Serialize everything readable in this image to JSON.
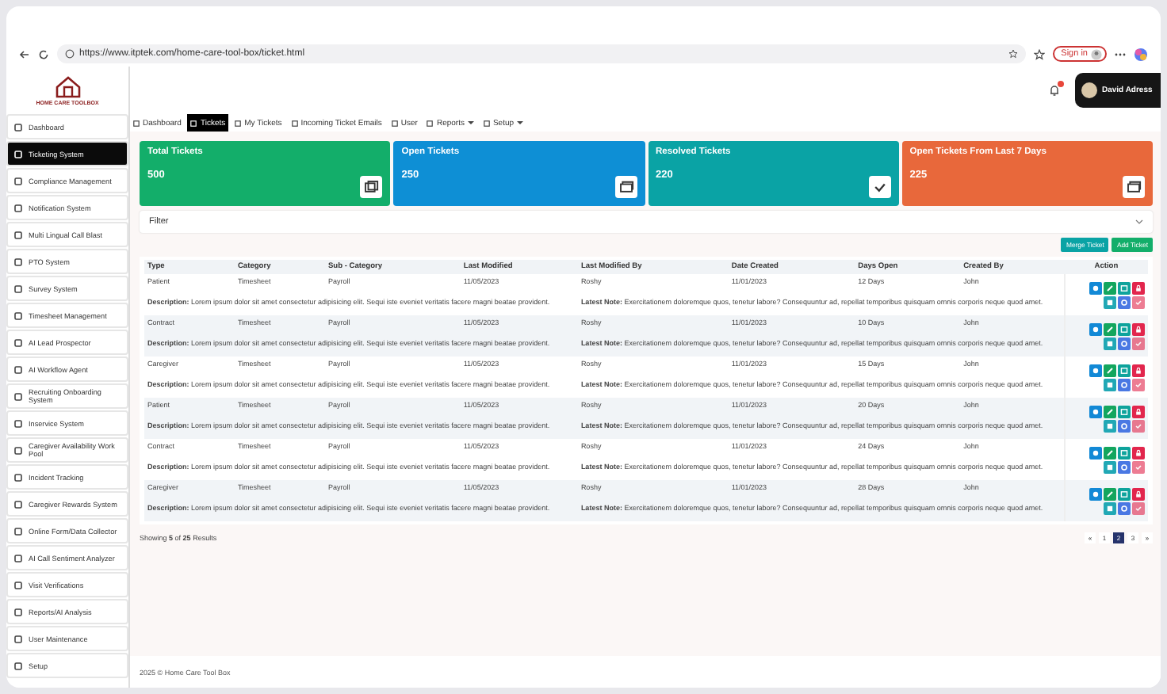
{
  "browser": {
    "url": "https://www.itptek.com/home-care-tool-box/ticket.html",
    "sign_in": "Sign in"
  },
  "logo": {
    "name": "HOME CARE TOOLBOX"
  },
  "sidebar": {
    "items": [
      {
        "label": "Dashboard",
        "selected": false
      },
      {
        "label": "Ticketing System",
        "selected": true
      },
      {
        "label": "Compliance Management",
        "selected": false
      },
      {
        "label": "Notification System",
        "selected": false
      },
      {
        "label": "Multi Lingual Call Blast",
        "selected": false
      },
      {
        "label": "PTO System",
        "selected": false
      },
      {
        "label": "Survey System",
        "selected": false
      },
      {
        "label": "Timesheet Management",
        "selected": false
      },
      {
        "label": "AI Lead Prospector",
        "selected": false
      },
      {
        "label": "AI Workflow Agent",
        "selected": false
      },
      {
        "label": "Recruiting Onboarding System",
        "selected": false
      },
      {
        "label": "Inservice System",
        "selected": false
      },
      {
        "label": "Caregiver Availability Work Pool",
        "selected": false
      },
      {
        "label": "Incident Tracking",
        "selected": false
      },
      {
        "label": "Caregiver Rewards System",
        "selected": false
      },
      {
        "label": "Online Form/Data Collector",
        "selected": false
      },
      {
        "label": "AI Call Sentiment Analyzer",
        "selected": false
      },
      {
        "label": "Visit Verifications",
        "selected": false
      },
      {
        "label": "Reports/AI Analysis",
        "selected": false
      },
      {
        "label": "User Maintenance",
        "selected": false
      },
      {
        "label": "Setup",
        "selected": false
      }
    ]
  },
  "header": {
    "user": "David Adress"
  },
  "nav": [
    {
      "label": "Dashboard",
      "selected": false,
      "dropdown": false
    },
    {
      "label": "Tickets",
      "selected": true,
      "dropdown": false
    },
    {
      "label": "My Tickets",
      "selected": false,
      "dropdown": false
    },
    {
      "label": "Incoming Ticket Emails",
      "selected": false,
      "dropdown": false
    },
    {
      "label": "User",
      "selected": false,
      "dropdown": false
    },
    {
      "label": "Reports",
      "selected": false,
      "dropdown": true
    },
    {
      "label": "Setup",
      "selected": false,
      "dropdown": true
    }
  ],
  "cards": [
    {
      "kind": "total",
      "title": "Total Tickets",
      "value": "500"
    },
    {
      "kind": "open",
      "title": "Open Tickets",
      "value": "250"
    },
    {
      "kind": "resolved",
      "title": "Resolved Tickets",
      "value": "220"
    },
    {
      "kind": "recent",
      "title": "Open Tickets From Last 7 Days",
      "value": "225"
    }
  ],
  "filter": {
    "label": "Filter",
    "expanded": false
  },
  "buttons": [
    {
      "kind": "merge",
      "label": "Merge Ticket"
    },
    {
      "kind": "add",
      "label": "Add Ticket"
    }
  ],
  "table": {
    "columns": [
      "Type",
      "Category",
      "Sub - Category",
      "Last Modified",
      "Last Modified By",
      "Date Created",
      "Days Open",
      "Created By",
      "Action"
    ],
    "row_actions": [
      {
        "kind": "view",
        "disabled": false
      },
      {
        "kind": "edit",
        "disabled": false
      },
      {
        "kind": "calendar",
        "disabled": false
      },
      {
        "kind": "lock",
        "disabled": false
      },
      {
        "kind": "list",
        "disabled": false
      },
      {
        "kind": "settings",
        "disabled": false
      },
      {
        "kind": "resolve",
        "disabled": true
      }
    ],
    "rows": [
      {
        "type": "Patient",
        "category": "Timesheet",
        "sub_category": "Payroll",
        "last_modified": "11/05/2023",
        "modified_by": "Roshy",
        "date_created": "11/01/2023",
        "days_open": "12 Days",
        "created_by": "John",
        "description": "**Description:** Lorem ipsum dolor sit amet consectetur adipisicing elit. Sequi iste eveniet veritatis facere magni beatae provident.",
        "note": "**Latest Note:** Exercitationem doloremque quos, tenetur labore? Consequuntur ad, repellat temporibus quisquam omnis corporis neque quod amet."
      },
      {
        "type": "Contract",
        "category": "Timesheet",
        "sub_category": "Payroll",
        "last_modified": "11/05/2023",
        "modified_by": "Roshy",
        "date_created": "11/01/2023",
        "days_open": "10 Days",
        "created_by": "John",
        "description": "**Description:** Lorem ipsum dolor sit amet consectetur adipisicing elit. Sequi iste eveniet veritatis facere magni beatae provident.",
        "note": "**Latest Note:** Exercitationem doloremque quos, tenetur labore? Consequuntur ad, repellat temporibus quisquam omnis corporis neque quod amet."
      },
      {
        "type": "Caregiver",
        "category": "Timesheet",
        "sub_category": "Payroll",
        "last_modified": "11/05/2023",
        "modified_by": "Roshy",
        "date_created": "11/01/2023",
        "days_open": "15 Days",
        "created_by": "John",
        "description": "**Description:** Lorem ipsum dolor sit amet consectetur adipisicing elit. Sequi iste eveniet veritatis facere magni beatae provident.",
        "note": "**Latest Note:** Exercitationem doloremque quos, tenetur labore? Consequuntur ad, repellat temporibus quisquam omnis corporis neque quod amet."
      },
      {
        "type": "Patient",
        "category": "Timesheet",
        "sub_category": "Payroll",
        "last_modified": "11/05/2023",
        "modified_by": "Roshy",
        "date_created": "11/01/2023",
        "days_open": "20 Days",
        "created_by": "John",
        "description": "**Description:** Lorem ipsum dolor sit amet consectetur adipisicing elit. Sequi iste eveniet veritatis facere magni beatae provident.",
        "note": "**Latest Note:** Exercitationem doloremque quos, tenetur labore? Consequuntur ad, repellat temporibus quisquam omnis corporis neque quod amet."
      },
      {
        "type": "Contract",
        "category": "Timesheet",
        "sub_category": "Payroll",
        "last_modified": "11/05/2023",
        "modified_by": "Roshy",
        "date_created": "11/01/2023",
        "days_open": "24 Days",
        "created_by": "John",
        "description": "**Description:** Lorem ipsum dolor sit amet consectetur adipisicing elit. Sequi iste eveniet veritatis facere magni beatae provident.",
        "note": "**Latest Note:** Exercitationem doloremque quos, tenetur labore? Consequuntur ad, repellat temporibus quisquam omnis corporis neque quod amet."
      },
      {
        "type": "Caregiver",
        "category": "Timesheet",
        "sub_category": "Payroll",
        "last_modified": "11/05/2023",
        "modified_by": "Roshy",
        "date_created": "11/01/2023",
        "days_open": "28 Days",
        "created_by": "John",
        "description": "**Description:** Lorem ipsum dolor sit amet consectetur adipisicing elit. Sequi iste eveniet veritatis facere magni beatae provident.",
        "note": "**Latest Note:** Exercitationem doloremque quos, tenetur labore? Consequuntur ad, repellat temporibus quisquam omnis corporis neque quod amet."
      }
    ]
  },
  "summary": "Showing **5** of **25** Results",
  "pagination": [
    {
      "label": "«",
      "selected": false
    },
    {
      "label": "1",
      "selected": false
    },
    {
      "label": "2",
      "selected": true
    },
    {
      "label": "3",
      "selected": false
    },
    {
      "label": "»",
      "selected": false
    }
  ],
  "footer": "2025 © Home Care Tool Box"
}
